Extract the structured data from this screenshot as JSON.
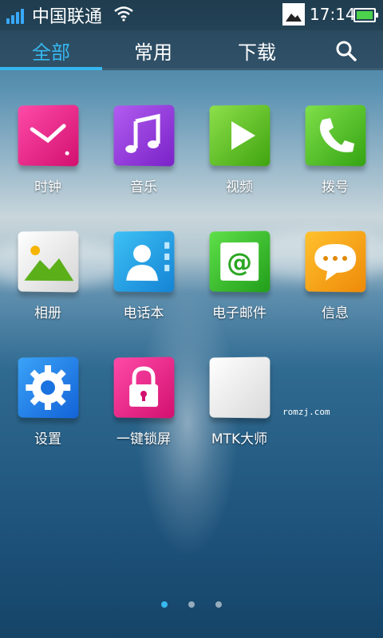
{
  "status_bar": {
    "carrier": "中国联通",
    "time": "17:14",
    "signal_bars": 4,
    "battery_level": 0.85,
    "icons": [
      "signal-icon",
      "wifi-icon",
      "gallery-icon",
      "battery-icon"
    ]
  },
  "tabs": [
    {
      "label": "全部",
      "active": true
    },
    {
      "label": "常用",
      "active": false
    },
    {
      "label": "下载",
      "active": false
    }
  ],
  "search_icon": "search-icon",
  "apps": [
    {
      "label": "时钟",
      "icon": "clock-icon",
      "color": "#e0197f"
    },
    {
      "label": "音乐",
      "icon": "music-icon",
      "color": "#8a3ad6"
    },
    {
      "label": "视频",
      "icon": "video-icon",
      "color": "#5cc11d"
    },
    {
      "label": "拨号",
      "icon": "phone-icon",
      "color": "#4cbf1a"
    },
    {
      "label": "相册",
      "icon": "gallery-icon",
      "color": "#e8e8e8"
    },
    {
      "label": "电话本",
      "icon": "contacts-icon",
      "color": "#1a9fe0"
    },
    {
      "label": "电子邮件",
      "icon": "email-icon",
      "color": "#34b82a"
    },
    {
      "label": "信息",
      "icon": "message-icon",
      "color": "#f39a13"
    },
    {
      "label": "设置",
      "icon": "settings-icon",
      "color": "#1e7fe0"
    },
    {
      "label": "一键锁屏",
      "icon": "lock-icon",
      "color": "#e0197f"
    },
    {
      "label": "MTK大师",
      "icon": "blank-app-icon",
      "color": "#eaeaea"
    }
  ],
  "watermark": "romzj.com",
  "page_indicator": {
    "pages": 3,
    "current": 1
  },
  "colors": {
    "accent": "#37b7ef"
  }
}
